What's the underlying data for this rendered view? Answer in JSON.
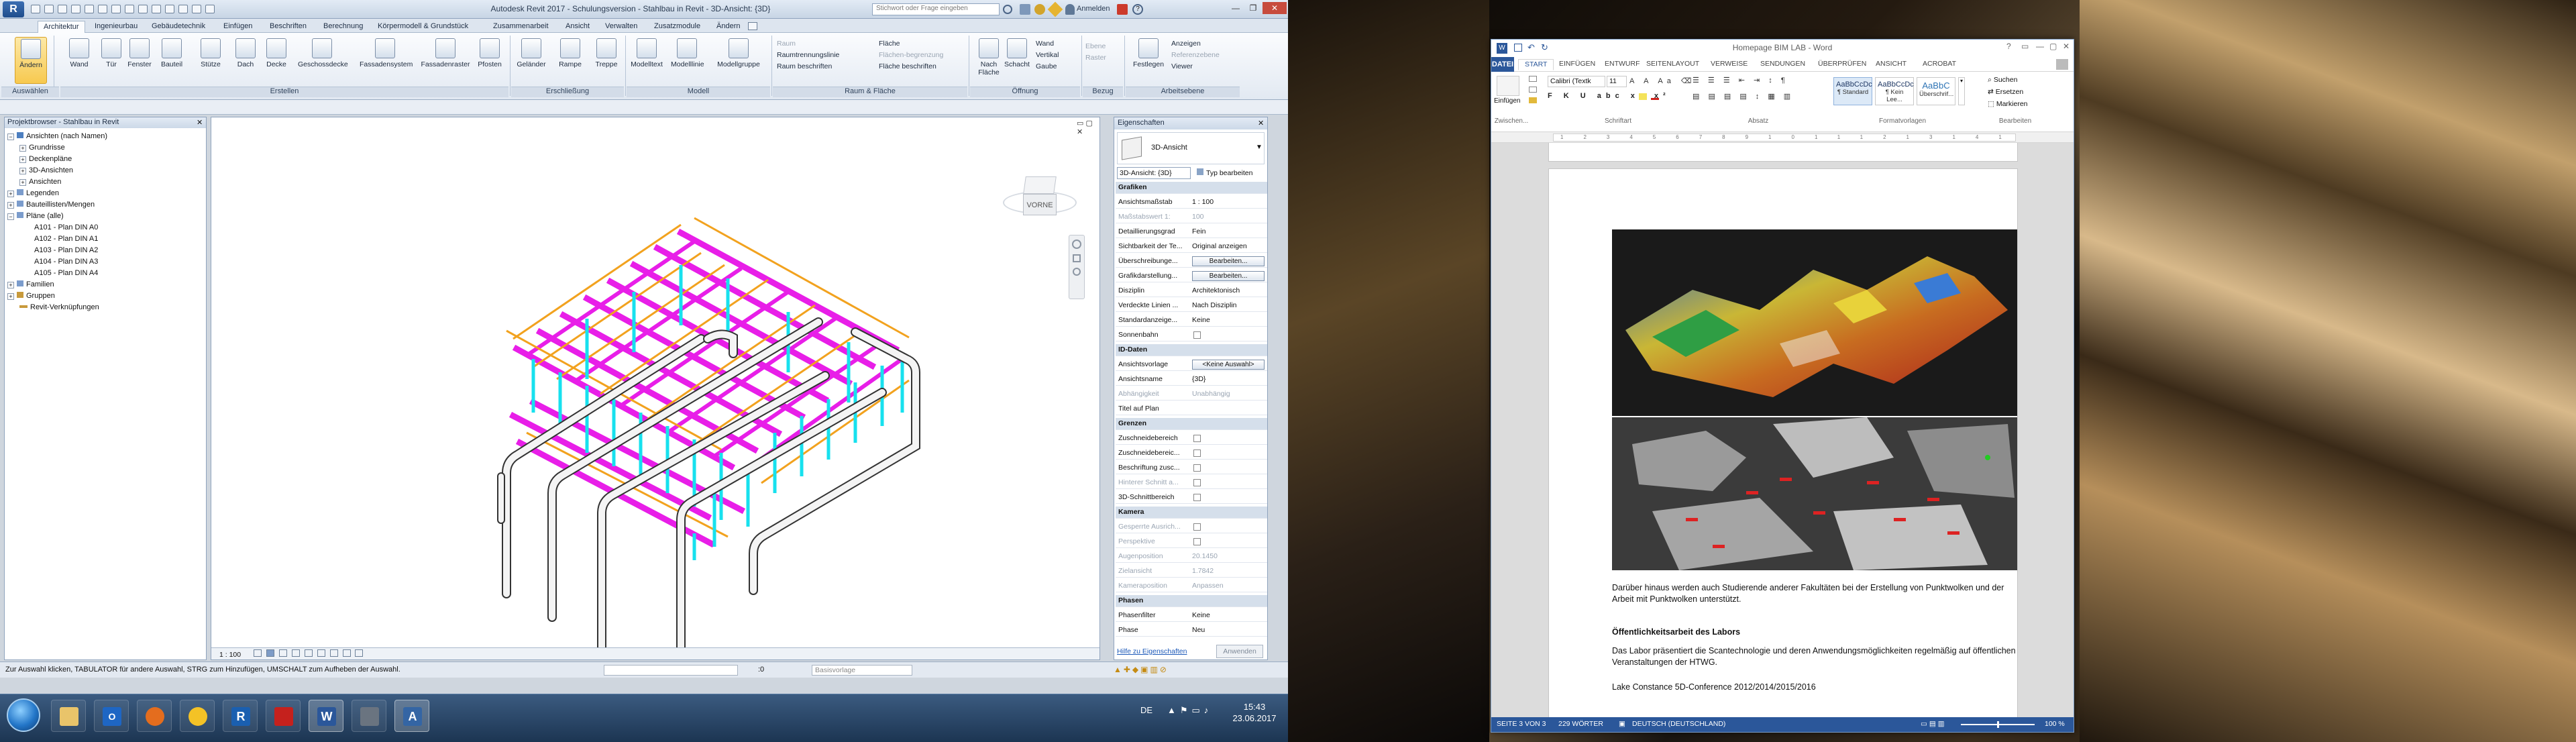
{
  "revit": {
    "app_button": "R",
    "title": "Autodesk Revit 2017 - Schulungsversion -  Stahlbau in Revit - 3D-Ansicht: {3D}",
    "search_placeholder": "Stichwort oder Frage eingeben",
    "login": "Anmelden",
    "tabs": [
      "Architektur",
      "Ingenieurbau",
      "Gebäudetechnik",
      "Einfügen",
      "Beschriften",
      "Berechnung",
      "Körpermodell & Grundstück",
      "Zusammenarbeit",
      "Ansicht",
      "Verwalten",
      "Zusatzmodule",
      "Ändern"
    ],
    "active_tab": "Architektur",
    "ribbon": {
      "tools": [
        "Ändern",
        "Wand",
        "Tür",
        "Fenster",
        "Bauteil",
        "Stütze",
        "Dach",
        "Decke",
        "Geschossdecke",
        "Fassadensystem",
        "Fassadenraster",
        "Pfosten",
        "Geländer",
        "Rampe",
        "Treppe",
        "Modelltext",
        "Modelllinie",
        "Modellgruppe",
        "Raum",
        "Nach Fläche",
        "Schacht",
        "Festlegen"
      ],
      "raum_small": [
        "Raumtrennungslinie",
        "Raum beschriften"
      ],
      "raum_dim": [
        "Raum"
      ],
      "flaeche_small": [
        "Fläche",
        "Fläche beschriften"
      ],
      "flaeche_dim": [
        "Flächen-begrenzung"
      ],
      "oeffnung_small": [
        "Wand",
        "Vertikal",
        "Gaube"
      ],
      "bezug_small": [
        "Ebene",
        "Raster"
      ],
      "arbeitsebene_small": [
        "Anzeigen",
        "Referenzebene",
        "Viewer"
      ],
      "panels": [
        "Auswählen",
        "Erstellen",
        "Erschließung",
        "Modell",
        "Raum & Fläche",
        "Öffnung",
        "Bezug",
        "Arbeitsebene"
      ]
    },
    "project_browser": {
      "title": "Projektbrowser - Stahlbau in Revit",
      "items": [
        {
          "label": "Ansichten (nach Namen)",
          "level": 0,
          "toggle": "−"
        },
        {
          "label": "Grundrisse",
          "level": 1,
          "toggle": "+"
        },
        {
          "label": "Deckenpläne",
          "level": 1,
          "toggle": "+"
        },
        {
          "label": "3D-Ansichten",
          "level": 1,
          "toggle": "+"
        },
        {
          "label": "Ansichten",
          "level": 1,
          "toggle": "+"
        },
        {
          "label": "Legenden",
          "level": 0,
          "toggle": "+"
        },
        {
          "label": "Bauteillisten/Mengen",
          "level": 0,
          "toggle": "+"
        },
        {
          "label": "Pläne (alle)",
          "level": 0,
          "toggle": "−"
        },
        {
          "label": "A101 - Plan DIN A0",
          "level": 2,
          "toggle": ""
        },
        {
          "label": "A102 - Plan DIN A1",
          "level": 2,
          "toggle": ""
        },
        {
          "label": "A103 - Plan DIN A2",
          "level": 2,
          "toggle": ""
        },
        {
          "label": "A104 - Plan DIN A3",
          "level": 2,
          "toggle": ""
        },
        {
          "label": "A105 - Plan DIN A4",
          "level": 2,
          "toggle": ""
        },
        {
          "label": "Familien",
          "level": 0,
          "toggle": "+"
        },
        {
          "label": "Gruppen",
          "level": 0,
          "toggle": "+"
        },
        {
          "label": "Revit-Verknüpfungen",
          "level": 0,
          "toggle": ""
        }
      ]
    },
    "viewcube_label": "VORNE",
    "view_scale": "1 : 100",
    "properties": {
      "title": "Eigenschaften",
      "type_name": "3D-Ansicht",
      "selector": "3D-Ansicht: {3D}",
      "edit_type": "Typ bearbeiten",
      "rows": [
        {
          "k": "Grafiken",
          "v": "",
          "grp": true
        },
        {
          "k": "Ansichtsmaßstab",
          "v": "1 : 100"
        },
        {
          "k": "Maßstabswert 1:",
          "v": "100",
          "dim": true
        },
        {
          "k": "Detaillierungsgrad",
          "v": "Fein"
        },
        {
          "k": "Sichtbarkeit der Te...",
          "v": "Original anzeigen"
        },
        {
          "k": "Überschreibunge...",
          "v": "Bearbeiten...",
          "btn": true
        },
        {
          "k": "Grafikdarstellung...",
          "v": "Bearbeiten...",
          "btn": true
        },
        {
          "k": "Disziplin",
          "v": "Architektonisch"
        },
        {
          "k": "Verdeckte Linien ...",
          "v": "Nach Disziplin"
        },
        {
          "k": "Standardanzeige...",
          "v": "Keine"
        },
        {
          "k": "Sonnenbahn",
          "v": "",
          "chk": true
        },
        {
          "k": "ID-Daten",
          "v": "",
          "grp": true
        },
        {
          "k": "Ansichtsvorlage",
          "v": "<Keine Auswahl>",
          "btn": true
        },
        {
          "k": "Ansichtsname",
          "v": "{3D}"
        },
        {
          "k": "Abhängigkeit",
          "v": "Unabhängig",
          "dim": true
        },
        {
          "k": "Titel auf Plan",
          "v": ""
        },
        {
          "k": "Grenzen",
          "v": "",
          "grp": true
        },
        {
          "k": "Zuschneidebereich",
          "v": "",
          "chk": true
        },
        {
          "k": "Zuschneidebereic...",
          "v": "",
          "chk": true
        },
        {
          "k": "Beschriftung zusc...",
          "v": "",
          "chk": true
        },
        {
          "k": "Hinterer Schnitt a...",
          "v": "",
          "chk": true,
          "dim": true
        },
        {
          "k": "3D-Schnittbereich",
          "v": "",
          "chk": true
        },
        {
          "k": "Kamera",
          "v": "",
          "grp": true
        },
        {
          "k": "Gesperrte Ausrich...",
          "v": "",
          "chk": true,
          "dim": true
        },
        {
          "k": "Perspektive",
          "v": "",
          "chk": true,
          "dim": true
        },
        {
          "k": "Augenposition",
          "v": "20.1450",
          "dim": true
        },
        {
          "k": "Zielansicht",
          "v": "1.7842",
          "dim": true
        },
        {
          "k": "Kameraposition",
          "v": "Anpassen",
          "dim": true
        },
        {
          "k": "Phasen",
          "v": "",
          "grp": true
        },
        {
          "k": "Phasenfilter",
          "v": "Keine"
        },
        {
          "k": "Phase",
          "v": "Neu"
        }
      ],
      "help_link": "Hilfe zu Eigenschaften",
      "apply": "Anwenden"
    },
    "status_text": "Zur Auswahl klicken, TABULATOR für andere Auswahl, STRG zum Hinzufügen, UMSCHALT zum Aufheben der Auswahl.",
    "status_zero": ":0",
    "status_model": "Basisvorlage"
  },
  "taskbar": {
    "apps": [
      "explorer",
      "outlook",
      "firefox",
      "chrome",
      "revit",
      "acrobat",
      "word",
      "settings",
      "autocad"
    ],
    "lang": "DE",
    "time": "15:43",
    "date": "23.06.2017"
  },
  "word": {
    "title": "Homepage BIM LAB - Word",
    "tabs": [
      "DATEI",
      "START",
      "EINFÜGEN",
      "ENTWURF",
      "SEITENLAYOUT",
      "VERWEISE",
      "SENDUNGEN",
      "ÜBERPRÜFEN",
      "ANSICHT",
      "ACROBAT"
    ],
    "active_tab": "START",
    "font_name": "Calibri (Textk",
    "font_size": "11",
    "paste_label": "Einfügen",
    "styles": [
      {
        "preview": "AaBbCcDc",
        "name": "¶ Standard"
      },
      {
        "preview": "AaBbCcDc",
        "name": "¶ Kein Lee..."
      },
      {
        "preview": "AaBbC",
        "name": "Überschrif..."
      }
    ],
    "editing": [
      "Suchen",
      "Ersetzen",
      "Markieren"
    ],
    "groups": [
      "Zwischen...",
      "Schriftart",
      "Absatz",
      "Formatvorlagen",
      "Bearbeiten"
    ],
    "body": {
      "p1": "Darüber hinaus werden auch Studierende anderer Fakultäten bei der Erstellung von Punktwolken und der Arbeit mit Punktwolken unterstützt.",
      "heading": "Öffentlichkeitsarbeit des Labors",
      "p2": "Das Labor präsentiert die Scantechnologie und deren Anwendungsmöglichkeiten regelmäßig auf öffentlichen Veranstaltungen der HTWG.",
      "p3": "Lake Constance 5D-Conference 2012/2014/2015/2016"
    },
    "status": {
      "page": "SEITE 3 VON 3",
      "words": "229 WÖRTER",
      "lang": "DEUTSCH (DEUTSCHLAND)",
      "zoom": "100 %"
    }
  },
  "colors": {
    "revit_blue": "#2b5fa6",
    "beam_magenta": "#e81ee8",
    "column_cyan": "#17e1ee",
    "brace_orange": "#f2a21e",
    "word_blue": "#2b579a"
  }
}
